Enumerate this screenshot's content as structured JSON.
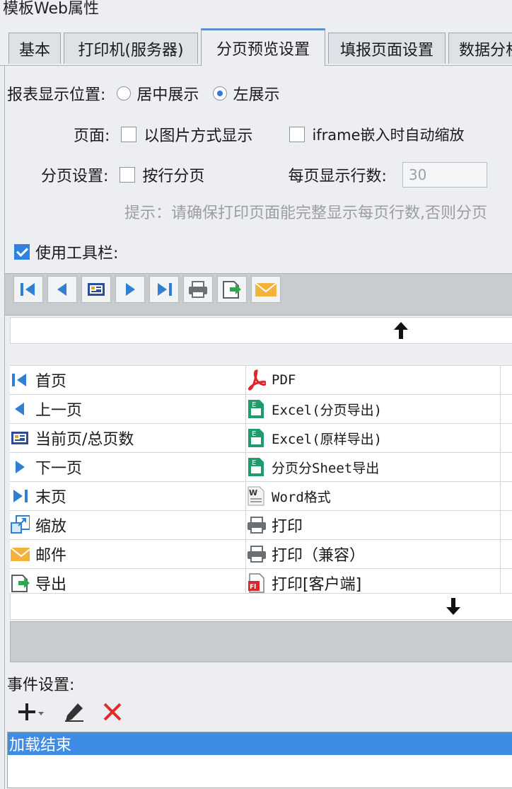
{
  "window_title": "模板Web属性",
  "tabs": [
    {
      "label": "基本",
      "active": false
    },
    {
      "label": "打印机(服务器)",
      "active": false
    },
    {
      "label": "分页预览设置",
      "active": true
    },
    {
      "label": "填报页面设置",
      "active": false
    },
    {
      "label": "数据分析",
      "active": false
    }
  ],
  "display_position": {
    "label": "报表显示位置:",
    "options": [
      {
        "label": "居中展示",
        "selected": false
      },
      {
        "label": "左展示",
        "selected": true
      }
    ]
  },
  "page": {
    "label": "页面:",
    "show_as_image": {
      "label": "以图片方式显示",
      "checked": false
    },
    "iframe_autoscale": {
      "label": "iframe嵌入时自动缩放",
      "checked": false
    }
  },
  "pagination": {
    "label": "分页设置:",
    "by_rows": {
      "label": "按行分页",
      "checked": false
    },
    "rows_per_page_label": "每页显示行数:",
    "rows_per_page_value": "30",
    "hint": "提示：请确保打印页面能完整显示每页行数,否则分页"
  },
  "use_toolbar": {
    "label": "使用工具栏:",
    "checked": true
  },
  "toolbar_preview": [
    "first-page-icon",
    "prev-page-icon",
    "page-count-icon",
    "next-page-icon",
    "last-page-icon",
    "print-icon",
    "export-icon",
    "email-icon"
  ],
  "toolbar_items": [
    [
      "首页",
      "PDF"
    ],
    [
      "上一页",
      "Excel(分页导出)"
    ],
    [
      "当前页/总页数",
      "Excel(原样导出)"
    ],
    [
      "下一页",
      "分页分Sheet导出"
    ],
    [
      "末页",
      "Word格式"
    ],
    [
      "缩放",
      "打印"
    ],
    [
      "邮件",
      "打印（兼容）"
    ],
    [
      "导出",
      "打印[客户端]"
    ]
  ],
  "events": {
    "label": "事件设置:",
    "items": [
      "加载结束"
    ]
  },
  "colors": {
    "accent": "#2f82e0",
    "selection": "#3f8ce6",
    "delete": "#e02b2b"
  }
}
